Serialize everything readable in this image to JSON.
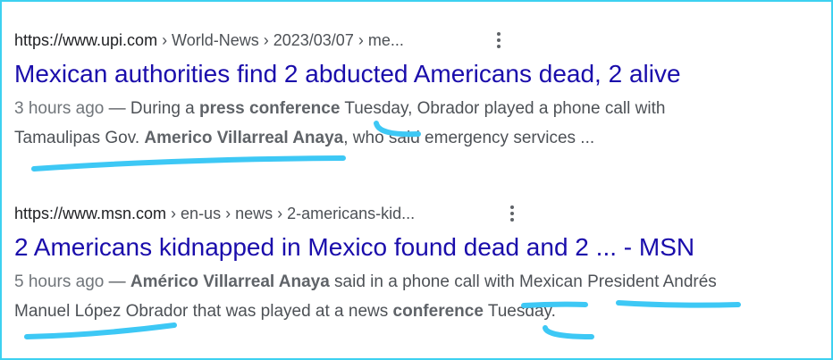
{
  "results": [
    {
      "url_domain": "https://www.upi.com",
      "url_crumbs": " › World-News › 2023/03/07 › me...",
      "title": "Mexican authorities find 2 abducted Americans dead, 2 alive",
      "snippet": {
        "date": "3 hours ago",
        "dash": " — ",
        "t1": "During a ",
        "b1": "press conference",
        "t2": " Tuesday, Obrador played a phone call with",
        "t3": "Tamaulipas Gov. ",
        "b2": "Americo Villarreal Anaya",
        "t4": ", who said emergency services ..."
      }
    },
    {
      "url_domain": "https://www.msn.com",
      "url_crumbs": " › en-us › news › 2-americans-kid...",
      "title": "2 Americans kidnapped in Mexico found dead and 2 ... - MSN",
      "snippet": {
        "date": "5 hours ago",
        "dash": " — ",
        "b1": "Américo Villarreal Anaya",
        "t1": " said in a phone call with Mexican President Andrés",
        "t2": "Manuel López Obrador that was played at a news ",
        "b2": "conference",
        "t3": " Tuesday."
      }
    }
  ],
  "colors": {
    "annotation": "#3dc8f5",
    "frame": "#3dd1f0",
    "link": "#1a0dab"
  }
}
